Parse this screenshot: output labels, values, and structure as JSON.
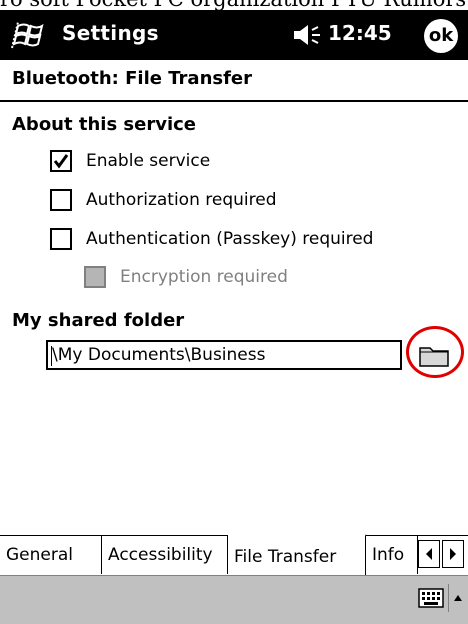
{
  "top_fragment": "ro soft Pocket PC organization PTU Rumors and ote",
  "titlebar": {
    "app_title": "Settings",
    "time": "12:45",
    "ok_label": "ok",
    "start_icon": "windows-flag-icon",
    "volume_icon": "speaker-icon"
  },
  "header": {
    "title": "Bluetooth: File Transfer"
  },
  "about": {
    "title": "About this service",
    "options": [
      {
        "label": "Enable service",
        "checked": true,
        "enabled": true
      },
      {
        "label": "Authorization required",
        "checked": false,
        "enabled": true
      },
      {
        "label": "Authentication (Passkey) required",
        "checked": false,
        "enabled": true
      },
      {
        "label": "Encryption required",
        "checked": false,
        "enabled": false
      }
    ]
  },
  "shared_folder": {
    "title": "My shared folder",
    "value": "\\My Documents\\Business",
    "browse_icon": "folder-icon",
    "highlight_color": "#e00000"
  },
  "tabs": [
    {
      "label": "General",
      "active": false
    },
    {
      "label": "Accessibility",
      "active": false
    },
    {
      "label": "File Transfer",
      "active": true
    },
    {
      "label": "Info",
      "active": false
    }
  ],
  "bottom": {
    "keyboard_icon": "keyboard-icon",
    "sip_icon": "up-arrow-icon"
  }
}
